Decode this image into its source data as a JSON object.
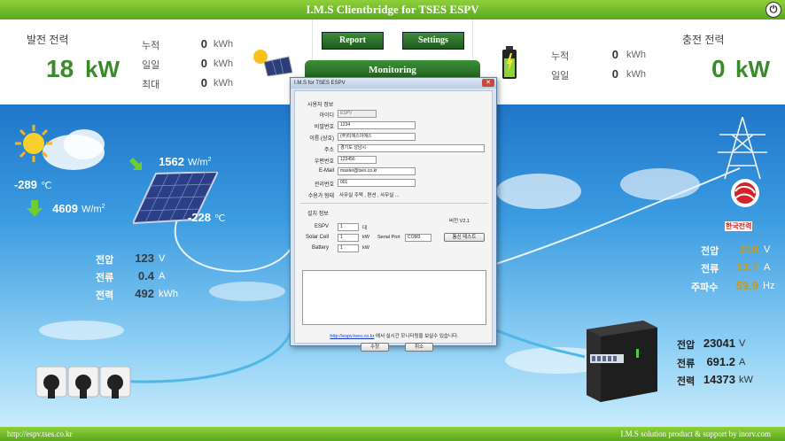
{
  "app": {
    "title": "I.M.S Clientbridge for TSES ESPV",
    "power_icon": "power-icon"
  },
  "header": {
    "generation": {
      "label": "발전 전력",
      "value": "18",
      "unit": "kW",
      "rows": [
        {
          "label": "누적",
          "value": "0",
          "unit": "kWh"
        },
        {
          "label": "일일",
          "value": "0",
          "unit": "kWh"
        },
        {
          "label": "최대",
          "value": "0",
          "unit": "kWh"
        }
      ]
    },
    "charge": {
      "label": "충전 전력",
      "value": "0",
      "unit": "kW",
      "rows": [
        {
          "label": "누적",
          "value": "0",
          "unit": "kWh"
        },
        {
          "label": "일일",
          "value": "0",
          "unit": "kWh"
        }
      ]
    },
    "buttons": {
      "report": "Report",
      "settings": "Settings"
    },
    "monitoring_tab": "Monitoring"
  },
  "weather": {
    "temp_air": "-289",
    "temp_air_unit": "℃",
    "irradiance_tilt": "1562",
    "irradiance_tilt_unit": "W/m",
    "irradiance_horiz": "4609",
    "irradiance_horiz_unit": "W/m",
    "temp_module": "-228",
    "temp_module_unit": "℃",
    "sup": "2"
  },
  "solar_panel": {
    "voltage_label": "전압",
    "voltage": "123",
    "voltage_unit": "V",
    "current_label": "전류",
    "current": "0.4",
    "current_unit": "A",
    "power_label": "전력",
    "power": "492",
    "power_unit": "kWh"
  },
  "grid": {
    "voltage_label": "전압",
    "voltage": "218",
    "voltage_unit": "V",
    "current_label": "전류",
    "current": "13.7",
    "current_unit": "A",
    "freq_label": "주파수",
    "freq": "59.9",
    "freq_unit": "Hz",
    "kepco_label": "한국전력"
  },
  "ess": {
    "voltage_label": "전압",
    "voltage": "23041",
    "voltage_unit": "V",
    "current_label": "전류",
    "current": "691.2",
    "current_unit": "A",
    "power_label": "전력",
    "power": "14373",
    "power_unit": "kW"
  },
  "footer": {
    "left": "http://espv.tses.co.kr",
    "right": "I.M.S solution product & support by inorv.com"
  },
  "dialog": {
    "title": "I.M.S for TSES ESPV",
    "user_section": "사용자 정보",
    "fields": [
      {
        "label": "아이디",
        "value": "ESPV",
        "disabled": true
      },
      {
        "label": "비밀번호",
        "value": "1234"
      },
      {
        "label": "이름 (상호)",
        "value": "(주)티에스이에스"
      },
      {
        "label": "주소",
        "value": "경기도 성남시"
      },
      {
        "label": "우편번호",
        "value": "123456"
      },
      {
        "label": "E-Mail",
        "value": "master@tses.co.kr"
      },
      {
        "label": "관리번호",
        "value": "001"
      }
    ],
    "consumer_type_label": "수용가 형태",
    "consumer_type_options": "사무실    주택 , 편션 , 사무실 ...",
    "install_section": "설치 정보",
    "version": "버전 V2.1",
    "espv_label": "ESPV",
    "espv_value": "1",
    "espv_unit": "대",
    "solar_label": "Solar Cell",
    "solar_value": "1",
    "solar_unit": "kW",
    "battery_label": "Battery",
    "battery_value": "1",
    "battery_unit": "kW",
    "serial_port_label": "Serial Port",
    "serial_port_value": "COM3",
    "comm_test_button": "통신 테스트",
    "link_url": "http://espv.tses.co.kr",
    "link_suffix": " 에서 실시간 모니터링을 보실수 있습니다.",
    "ok_button": "수정",
    "cancel_button": "취소",
    "close_icon": "close-icon"
  }
}
